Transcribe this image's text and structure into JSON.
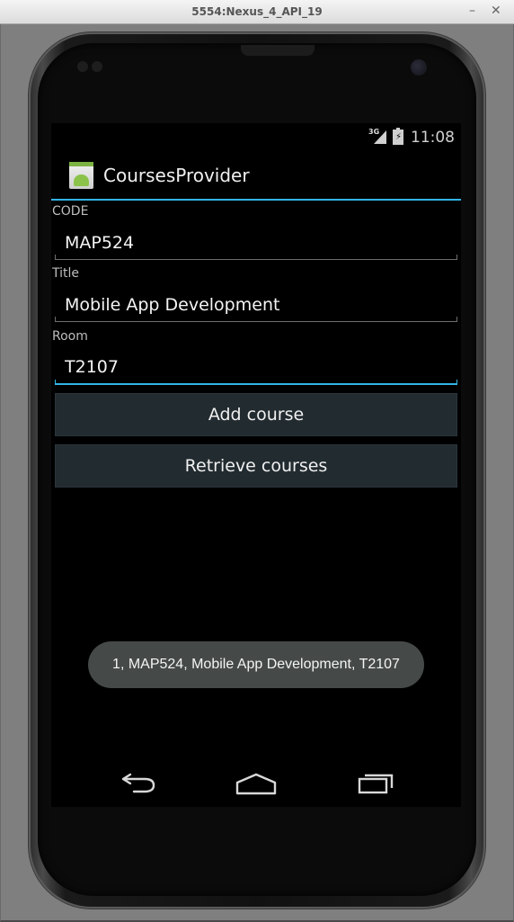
{
  "window": {
    "title": "5554:Nexus_4_API_19",
    "minimize_glyph": "–",
    "close_glyph": "✕"
  },
  "status_bar": {
    "network_label": "3G",
    "time": "11:08",
    "icons": [
      "signal-icon",
      "battery-icon"
    ]
  },
  "action_bar": {
    "app_title": "CoursesProvider",
    "icon": "android-app-icon"
  },
  "form": {
    "code": {
      "label": "CODE",
      "value": "MAP524"
    },
    "title": {
      "label": "Title",
      "value": "Mobile App Development"
    },
    "room": {
      "label": "Room",
      "value": "T2107",
      "focused": true
    }
  },
  "buttons": {
    "add": "Add course",
    "retrieve": "Retrieve courses"
  },
  "toast": {
    "message": "1, MAP524, Mobile App Development, T2107"
  },
  "nav_bar": {
    "icons": [
      "back-icon",
      "home-icon",
      "recents-icon"
    ]
  },
  "colors": {
    "accent": "#33b5e5",
    "button_bg": "#222b30",
    "toast_bg": "#454a48",
    "emulator_bg": "#7f7f7f"
  }
}
